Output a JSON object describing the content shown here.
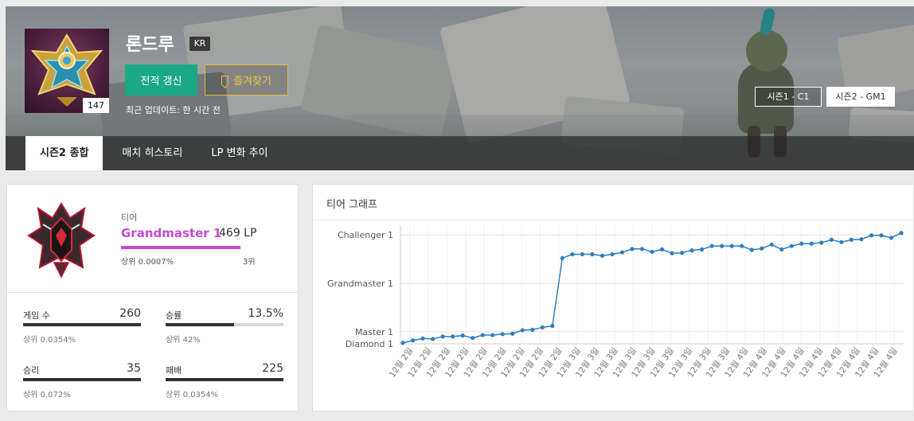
{
  "profile": {
    "summoner_name": "론드루",
    "region": "KR",
    "level": "147",
    "refresh_label": "전적 갱신",
    "favorite_label": "즐겨찾기",
    "last_updated": "최근 업데이트: 한 시간 전"
  },
  "seasons": [
    {
      "label": "시즌1 - C1",
      "selected": false
    },
    {
      "label": "시즌2 - GM1",
      "selected": true
    }
  ],
  "tabs": [
    {
      "label": "시즌2 종합",
      "active": true
    },
    {
      "label": "매치 히스토리",
      "active": false
    },
    {
      "label": "LP 변화 추이",
      "active": false
    }
  ],
  "tier": {
    "label": "티어",
    "name": "Grandmaster 1",
    "lp": "469 LP",
    "top_percent": "상위 0.0007%",
    "rank": "3위",
    "accent_color": "#c64bd0"
  },
  "stats": {
    "games": {
      "label": "게임 수",
      "value": "260",
      "sub": "상위 0.0354%",
      "fill": 1.0
    },
    "winrate": {
      "label": "승률",
      "value": "13.5%",
      "sub": "상위 42%",
      "fill": 0.58
    },
    "wins": {
      "label": "승리",
      "value": "35",
      "sub": "상위 0.072%",
      "fill": 1.0
    },
    "losses": {
      "label": "패배",
      "value": "225",
      "sub": "상위 0.0354%",
      "fill": 1.0
    }
  },
  "graph": {
    "title": "티어 그래프"
  },
  "colors": {
    "refresh_button": "#1aa886",
    "favorite_border": "#e8b83a",
    "line": "#2d7fc1"
  },
  "chart_data": {
    "type": "line",
    "title": "티어 그래프",
    "y_tick_labels": [
      "Challenger 1",
      "Grandmaster 1",
      "Master 1",
      "Diamond 1"
    ],
    "y_tick_values": [
      3,
      2,
      1,
      0.75
    ],
    "x_tick_labels": [
      "12월 2일",
      "12월 2일",
      "12월 2일",
      "12월 2일",
      "12월 2일",
      "12월 2일",
      "12월 2일",
      "12월 2일",
      "12월 2일",
      "12월 3일",
      "12월 3일",
      "12월 3일",
      "12월 3일",
      "12월 3일",
      "12월 3일",
      "12월 3일",
      "12월 3일",
      "12월 3일",
      "12월 4일",
      "12월 4일",
      "12월 4일",
      "12월 4일",
      "12월 4일",
      "12월 4일",
      "12월 4일",
      "12월 4일",
      "12월 4일"
    ],
    "ylim": [
      0.75,
      3.2
    ],
    "grid": true,
    "series": [
      {
        "values": [
          0.77,
          0.82,
          0.86,
          0.85,
          0.9,
          0.9,
          0.92,
          0.87,
          0.93,
          0.93,
          0.95,
          0.96,
          1.03,
          1.04,
          1.09,
          1.12,
          2.52,
          2.6,
          2.6,
          2.6,
          2.57,
          2.6,
          2.64,
          2.71,
          2.71,
          2.65,
          2.7,
          2.62,
          2.63,
          2.68,
          2.7,
          2.77,
          2.77,
          2.77,
          2.77,
          2.69,
          2.72,
          2.8,
          2.7,
          2.77,
          2.82,
          2.82,
          2.84,
          2.9,
          2.85,
          2.9,
          2.91,
          2.99,
          2.99,
          2.94,
          3.04
        ]
      }
    ]
  }
}
